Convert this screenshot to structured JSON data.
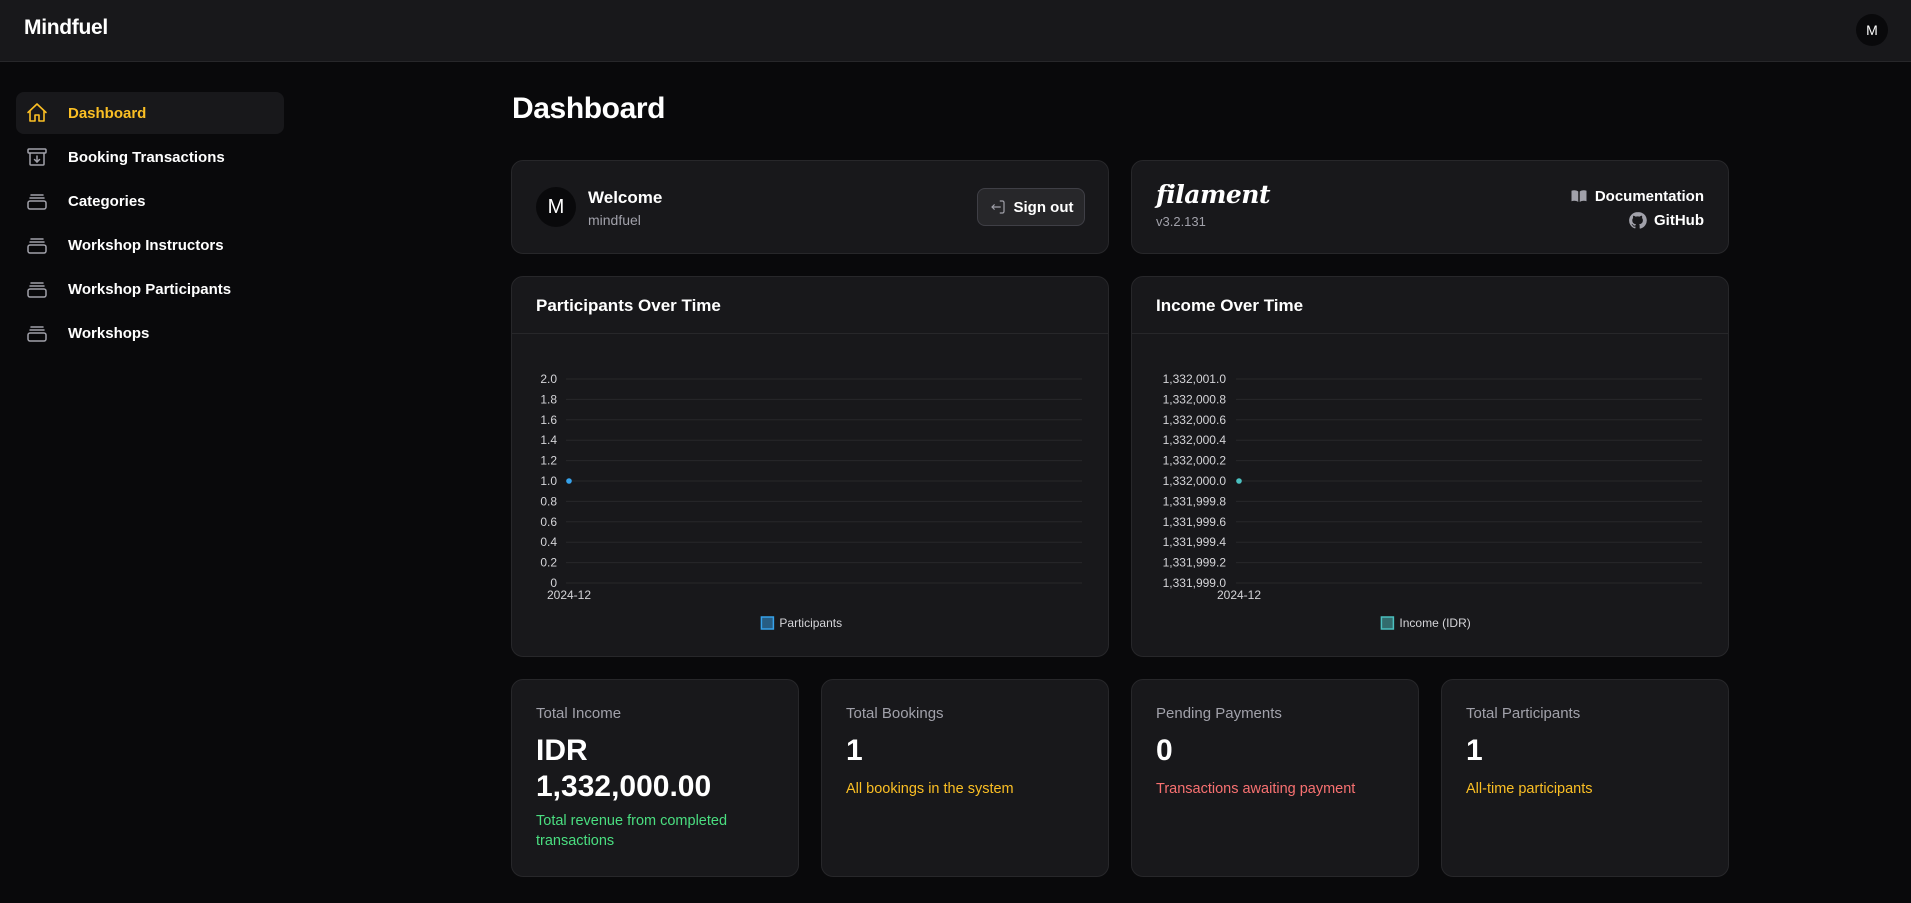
{
  "app": {
    "brand": "Mindfuel",
    "user_initial": "M"
  },
  "sidebar": {
    "items": [
      {
        "label": "Dashboard",
        "icon": "home-icon",
        "active": true
      },
      {
        "label": "Booking Transactions",
        "icon": "archive-box-arrow-down-icon"
      },
      {
        "label": "Categories",
        "icon": "rectangle-stack-icon"
      },
      {
        "label": "Workshop Instructors",
        "icon": "rectangle-stack-icon"
      },
      {
        "label": "Workshop Participants",
        "icon": "rectangle-stack-icon"
      },
      {
        "label": "Workshops",
        "icon": "rectangle-stack-icon"
      }
    ]
  },
  "page": {
    "title": "Dashboard"
  },
  "welcome": {
    "avatar_initial": "M",
    "title": "Welcome",
    "username": "mindfuel",
    "signout_label": "Sign out"
  },
  "filament": {
    "logo": "filament",
    "version": "v3.2.131",
    "documentation_label": "Documentation",
    "github_label": "GitHub"
  },
  "colors": {
    "accent": "#fbbf24",
    "participants_series": "#36a2eb",
    "income_series": "#4bc0c0",
    "success": "#4ade80",
    "danger": "#f87171"
  },
  "chart_data": [
    {
      "type": "line",
      "title": "Participants Over Time",
      "x": [
        "2024-12"
      ],
      "series": [
        {
          "name": "Participants",
          "values": [
            1
          ]
        }
      ],
      "ylim": [
        0,
        2
      ],
      "yticks": [
        "2.0",
        "1.8",
        "1.6",
        "1.4",
        "1.2",
        "1.0",
        "0.8",
        "0.6",
        "0.4",
        "0.2",
        "0"
      ],
      "grid": true,
      "legend": "bottom"
    },
    {
      "type": "line",
      "title": "Income Over Time",
      "x": [
        "2024-12"
      ],
      "series": [
        {
          "name": "Income (IDR)",
          "values": [
            1332000
          ]
        }
      ],
      "ylim": [
        1331999,
        1332001
      ],
      "yticks": [
        "1,332,001.0",
        "1,332,000.8",
        "1,332,000.6",
        "1,332,000.4",
        "1,332,000.2",
        "1,332,000.0",
        "1,331,999.8",
        "1,331,999.6",
        "1,331,999.4",
        "1,331,999.2",
        "1,331,999.0"
      ],
      "grid": true,
      "legend": "bottom"
    }
  ],
  "stats": [
    {
      "label": "Total Income",
      "value_line1": "IDR",
      "value_line2": "1,332,000.00",
      "description": "Total revenue from completed transactions"
    },
    {
      "label": "Total Bookings",
      "value": "1",
      "description": "All bookings in the system"
    },
    {
      "label": "Pending Payments",
      "value": "0",
      "description": "Transactions awaiting payment"
    },
    {
      "label": "Total Participants",
      "value": "1",
      "description": "All-time participants"
    }
  ]
}
